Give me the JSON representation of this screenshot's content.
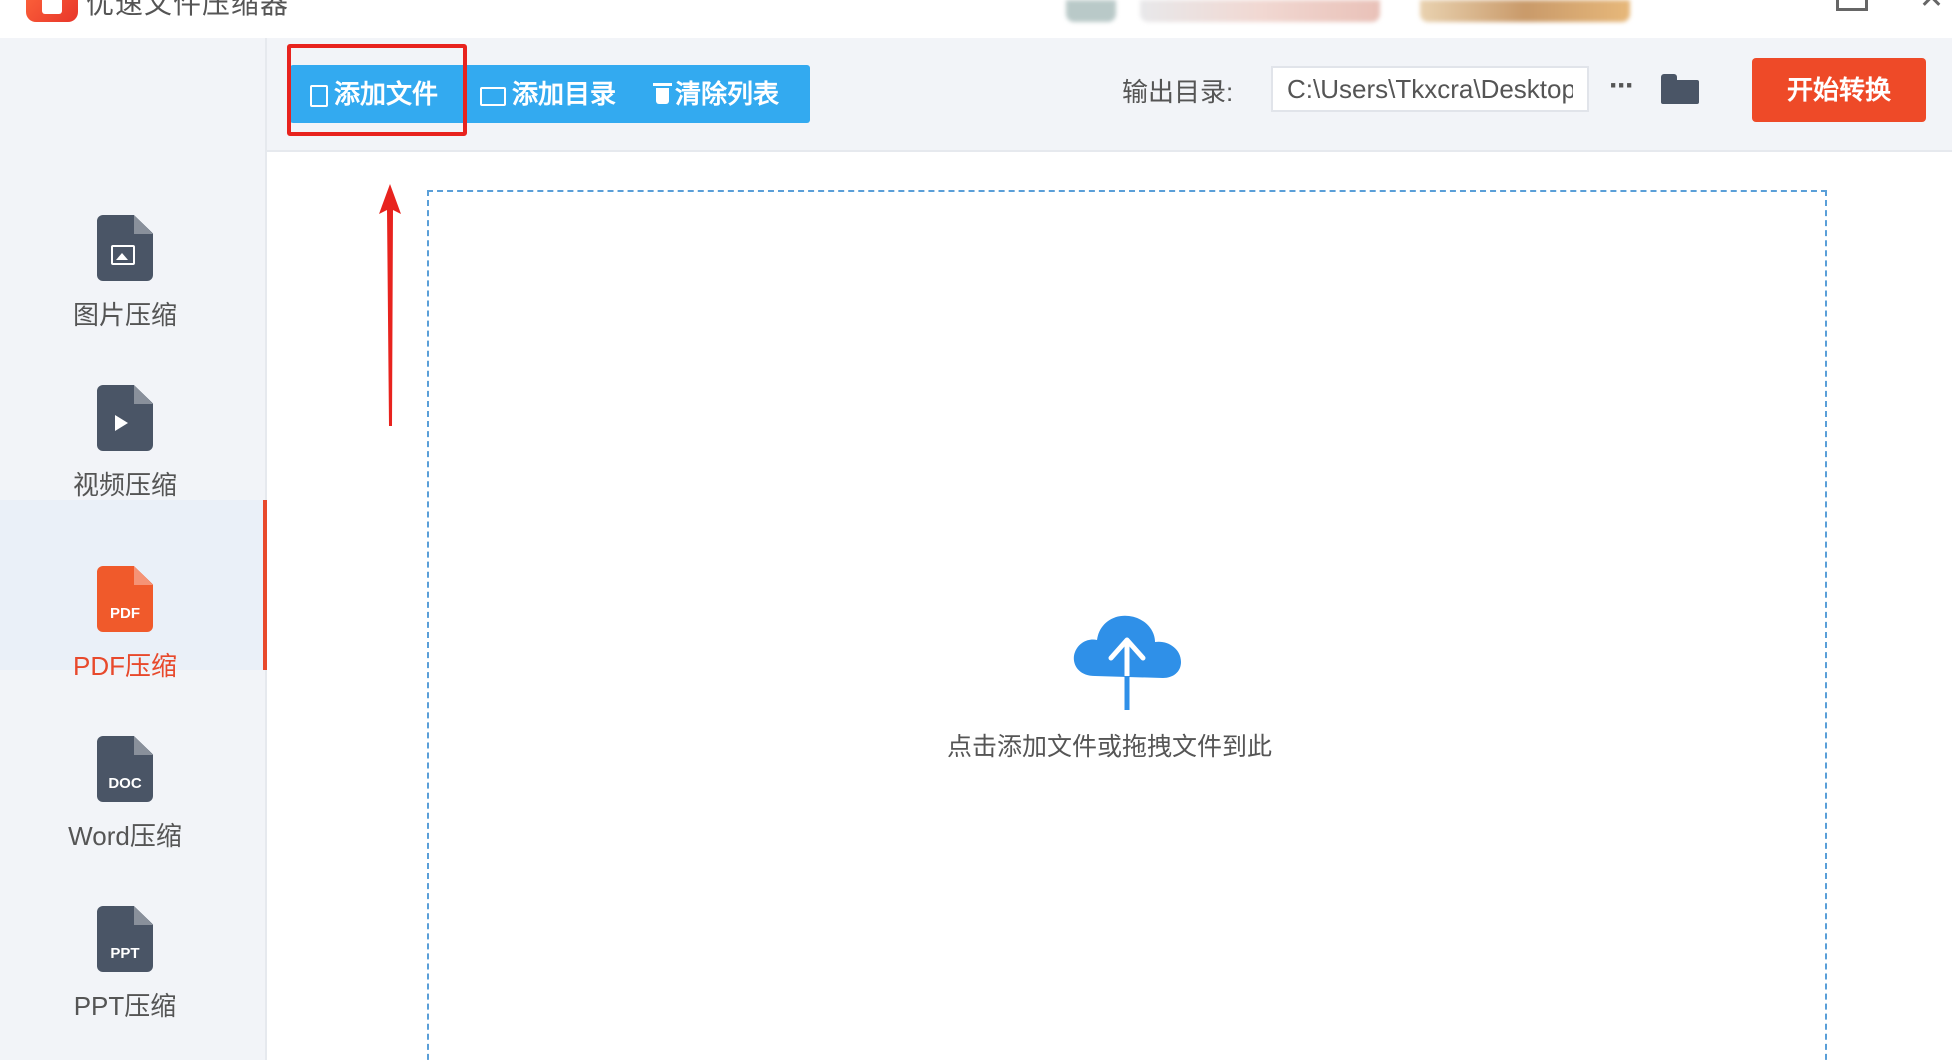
{
  "app": {
    "title": "优速文件压缩器"
  },
  "sidebar": {
    "items": [
      {
        "label": "图片压缩",
        "icon": "image-file-icon"
      },
      {
        "label": "视频压缩",
        "icon": "video-file-icon"
      },
      {
        "label": "PDF压缩",
        "icon": "pdf-file-icon",
        "glyph": "PDF",
        "active": true
      },
      {
        "label": "Word压缩",
        "icon": "doc-file-icon",
        "glyph": "DOC"
      },
      {
        "label": "PPT压缩",
        "icon": "ppt-file-icon",
        "glyph": "PPT"
      }
    ]
  },
  "toolbar": {
    "add_file": "添加文件",
    "add_folder": "添加目录",
    "clear_list": "清除列表",
    "output_label": "输出目录:",
    "output_value": "C:\\Users\\Tkxcra\\Desktop",
    "more": "···",
    "start": "开始转换"
  },
  "main": {
    "drop_hint": "点击添加文件或拖拽文件到此"
  },
  "colors": {
    "accent_blue": "#33aaf0",
    "accent_orange": "#ee4a28",
    "active_red": "#e8492c",
    "icon_gray": "#4a5566",
    "annotation_red": "#e8231e"
  }
}
